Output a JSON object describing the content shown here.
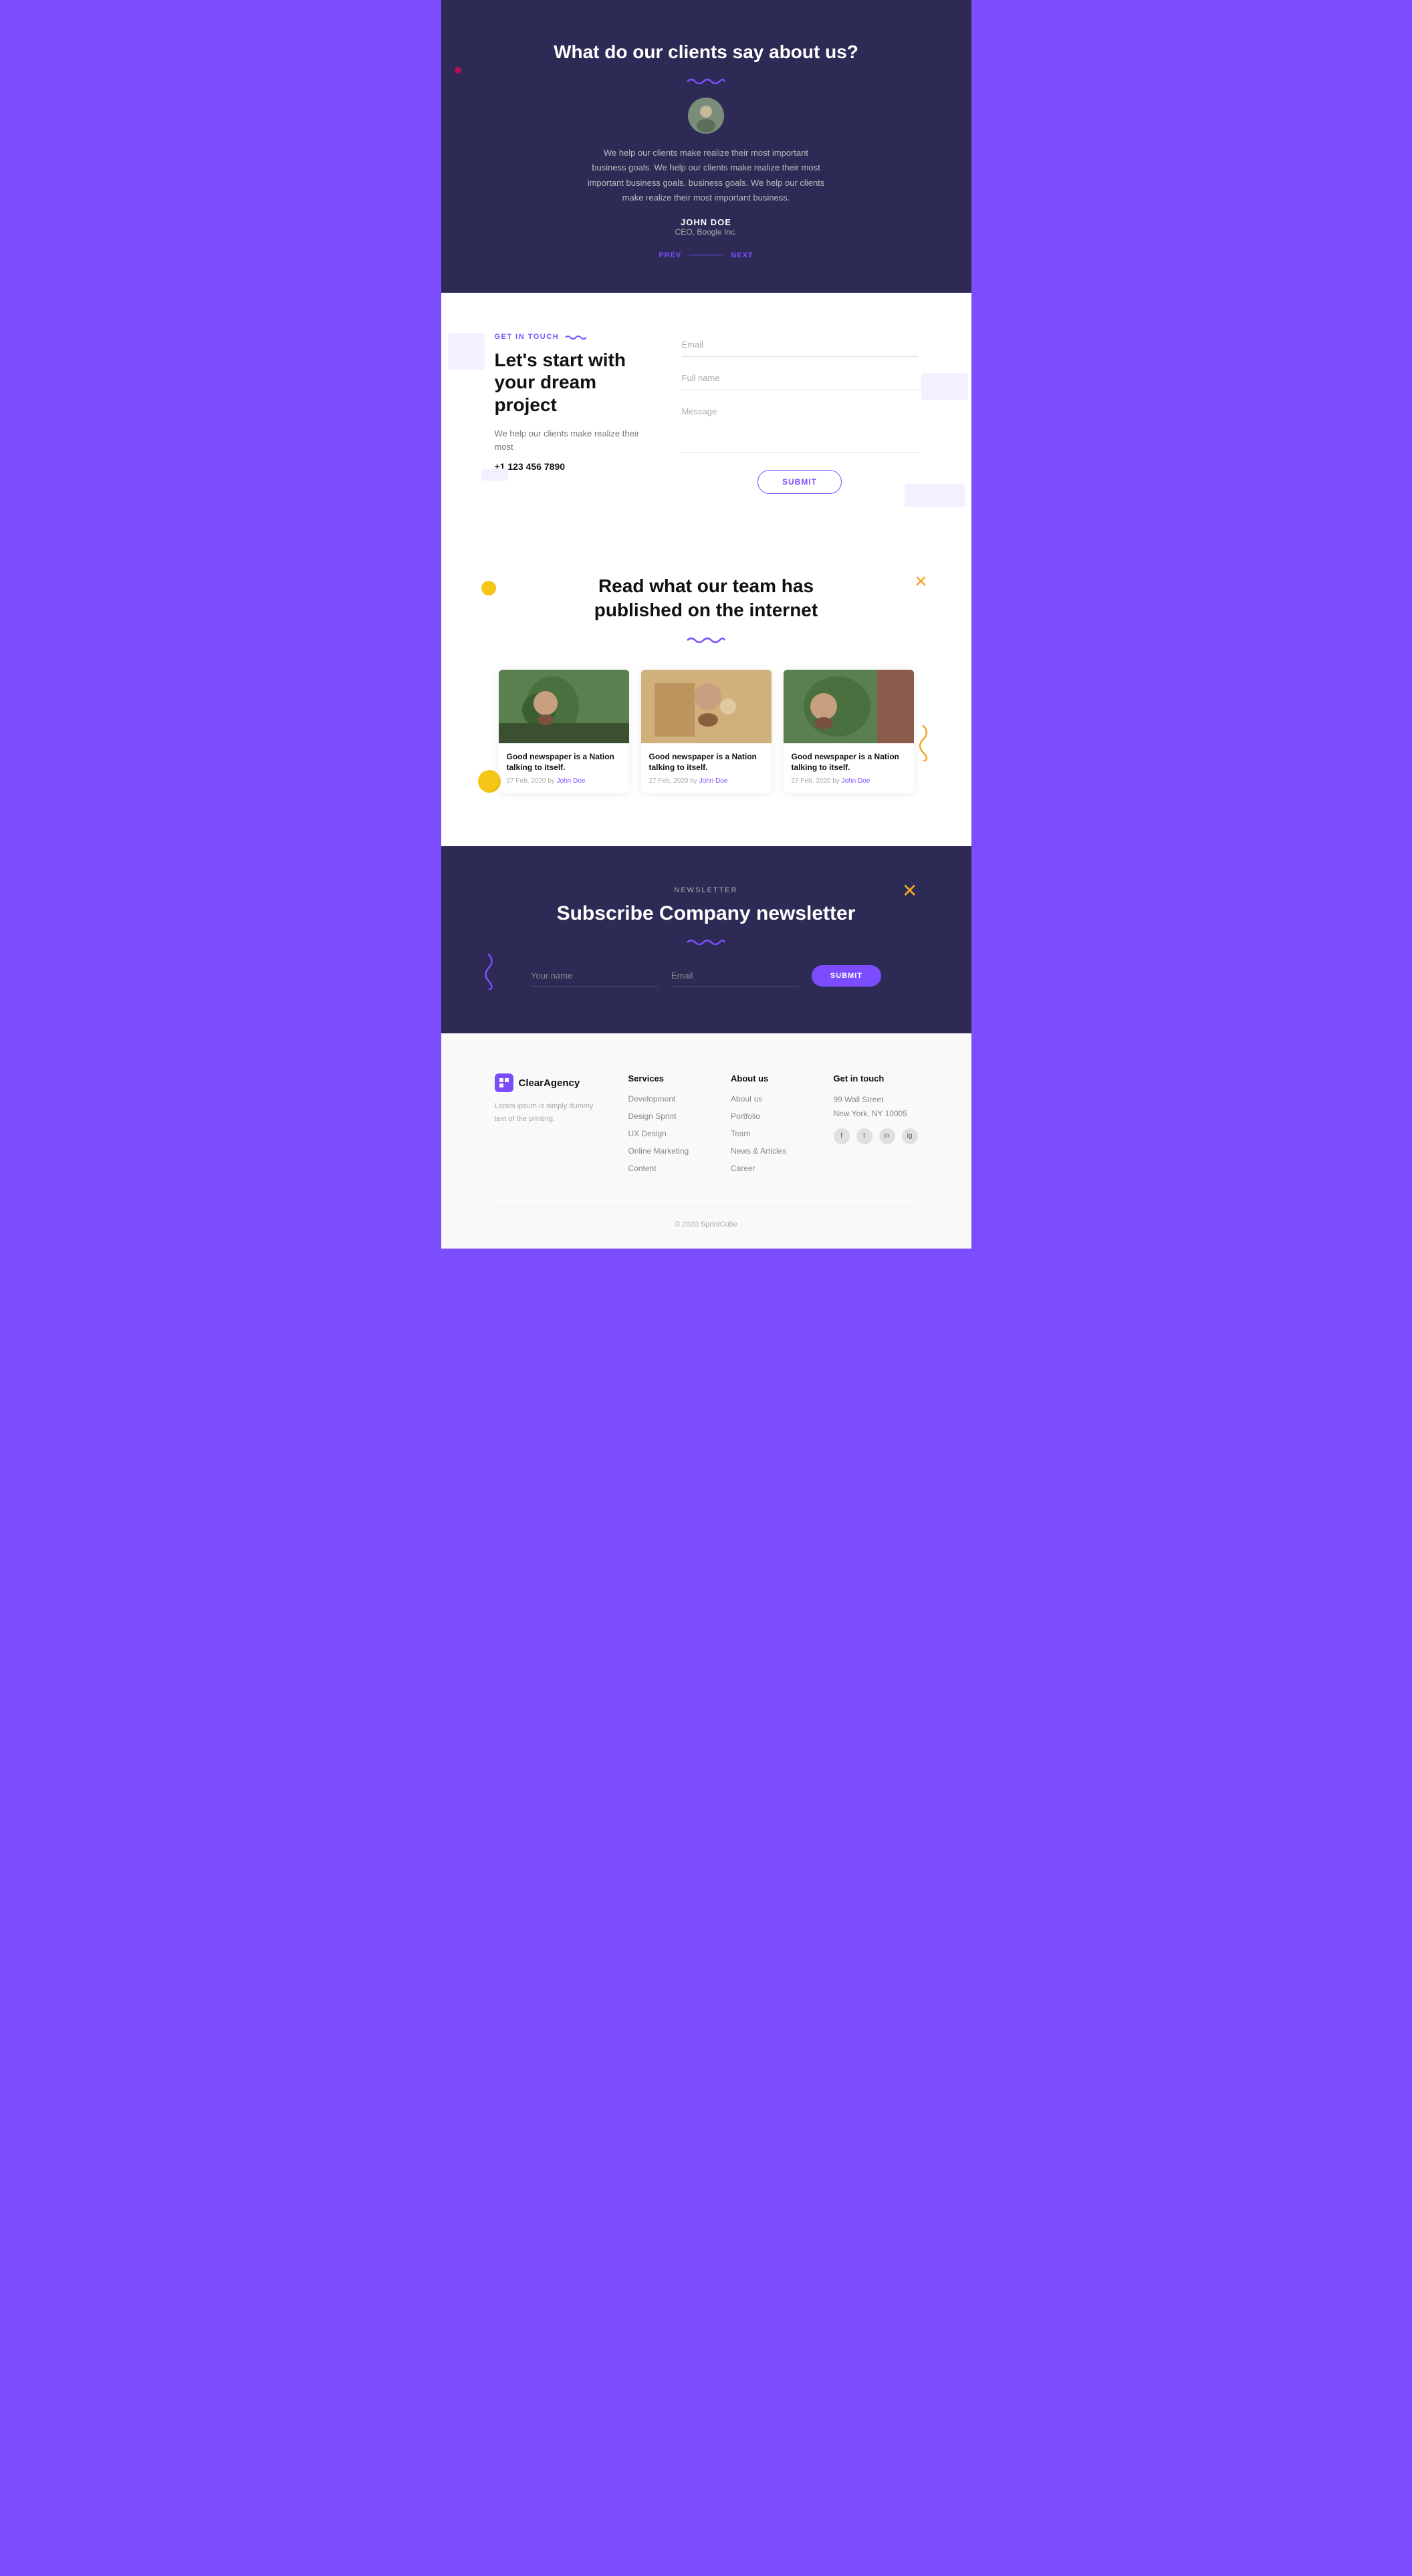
{
  "testimonial": {
    "title": "What do our clients say about us?",
    "body": "We help our clients make realize their most important business goals. We help our clients make realize their most important business goals. business goals. We help our clients make realize their most important business.",
    "name": "JOHN DOE",
    "role": "CEO, Boogle Inc.",
    "prev_label": "PREV",
    "next_label": "NEXT"
  },
  "contact": {
    "badge": "GET IN TOUCH",
    "title": "Let's start with your dream project",
    "desc": "We help our clients make realize their most",
    "phone": "+1 123 456 7890",
    "email_placeholder": "Email",
    "fullname_placeholder": "Full name",
    "message_placeholder": "Message",
    "submit_label": "SUBMIT"
  },
  "blog": {
    "title": "Read what our team has published on the internet",
    "cards": [
      {
        "title": "Good newspaper is a Nation talking to itself.",
        "date": "27 Feb, 2020",
        "author": "John Doe"
      },
      {
        "title": "Good newspaper is a Nation talking to itself.",
        "date": "27 Feb, 2020",
        "author": "John Doe"
      },
      {
        "title": "Good newspaper is a Nation talking to itself.",
        "date": "27 Feb, 2020",
        "author": "John Doe"
      }
    ]
  },
  "newsletter": {
    "badge": "NEWSLETTER",
    "title": "Subscribe Company newsletter",
    "name_placeholder": "Your name",
    "email_placeholder": "Email",
    "submit_label": "SUBMIT"
  },
  "footer": {
    "brand_name": "ClearAgency",
    "brand_desc": "Lorem ipsum is simply dummy text of the printing.",
    "services_title": "Services",
    "services": [
      "Development",
      "Design Sprint",
      "UX Design",
      "Online Marketing",
      "Content"
    ],
    "about_title": "About us",
    "about_links": [
      "About us",
      "Portfolio",
      "Team",
      "News & Articles",
      "Career"
    ],
    "contact_title": "Get in touch",
    "address": "99 Wall Street\nNew York, NY 10005",
    "copyright": "© 2020 SprintCube"
  }
}
